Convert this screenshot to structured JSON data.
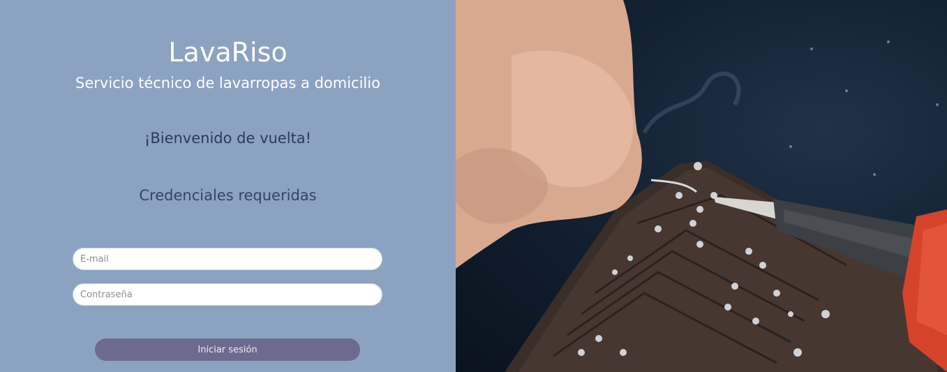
{
  "left": {
    "brand": "LavaRiso",
    "tagline": "Servicio técnico de lavarropas a domicilio",
    "welcome": "¡Bienvenido de vuelta!",
    "credentials_heading": "Credenciales requeridas"
  },
  "form": {
    "email_placeholder": "E-mail",
    "email_value": "",
    "password_placeholder": "Contraseña",
    "password_value": "",
    "submit_label": "Iniciar sesión"
  },
  "hero": {
    "image_alt": "soldering-circuit-board-photo"
  },
  "colors": {
    "left_bg": "#8ca2c1",
    "button_bg": "#6c6a8e",
    "welcome_text": "#2c3a5e"
  }
}
